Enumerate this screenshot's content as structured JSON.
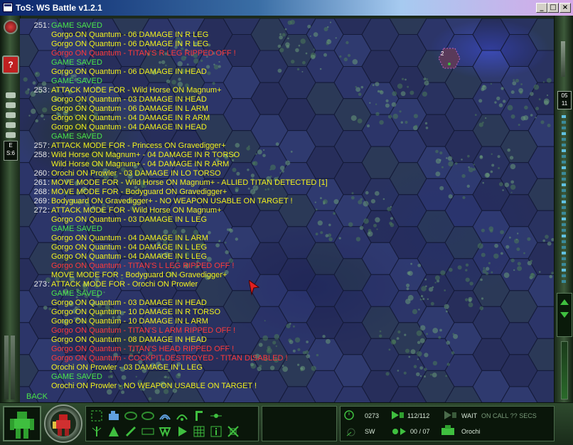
{
  "window": {
    "title": "ToS: WS Battle v1.2.1",
    "controls": {
      "minimize": "_",
      "maximize": "□",
      "close": "×"
    }
  },
  "left_rail": {
    "indicator_label": "E\nS:6"
  },
  "right_rail": {
    "counter_top": "05",
    "counter_bottom": "11",
    "bottom_value": "0"
  },
  "log": [
    {
      "num": "251",
      "text": "GAME SAVED",
      "color": "green"
    },
    {
      "num": "",
      "text": "Gorgo ON Quantum - 06 DAMAGE IN R LEG",
      "color": "yellow"
    },
    {
      "num": "",
      "text": "Gorgo ON Quantum - 06 DAMAGE IN R LEG",
      "color": "yellow"
    },
    {
      "num": "",
      "text": "Gorgo ON Quantum - TITAN'S R LEG RIPPED OFF !",
      "color": "red"
    },
    {
      "num": "",
      "text": "GAME SAVED",
      "color": "green"
    },
    {
      "num": "",
      "text": "Gorgo ON Quantum - 06 DAMAGE IN HEAD",
      "color": "yellow"
    },
    {
      "num": "",
      "text": "GAME SAVED",
      "color": "green"
    },
    {
      "num": "253",
      "text": "ATTACK MODE FOR - Wild Horse ON Magnum+",
      "color": "yellow"
    },
    {
      "num": "",
      "text": "Gorgo ON Quantum - 03 DAMAGE IN HEAD",
      "color": "yellow"
    },
    {
      "num": "",
      "text": "Gorgo ON Quantum - 06 DAMAGE IN L ARM",
      "color": "yellow"
    },
    {
      "num": "",
      "text": "Gorgo ON Quantum - 04 DAMAGE IN R ARM",
      "color": "yellow"
    },
    {
      "num": "",
      "text": "Gorgo ON Quantum - 04 DAMAGE IN HEAD",
      "color": "yellow"
    },
    {
      "num": "",
      "text": "GAME SAVED",
      "color": "green"
    },
    {
      "num": "257",
      "text": "ATTACK MODE FOR - Princess ON Gravedigger+",
      "color": "yellow"
    },
    {
      "num": "258",
      "text": "Wild Horse ON Magnum+ - 04 DAMAGE IN R TORSO",
      "color": "yellow"
    },
    {
      "num": "",
      "text": "Wild Horse ON Magnum+ - 04 DAMAGE IN R ARM",
      "color": "yellow"
    },
    {
      "num": "260",
      "text": "Orochi ON Prowler - 03 DAMAGE IN LO TORSO",
      "color": "yellow"
    },
    {
      "num": "261",
      "text": "MOVE MODE FOR - Wild Horse ON Magnum+ - ALLIED TITAN DETECTED [1]",
      "color": "yellow"
    },
    {
      "num": "268",
      "text": "MOVE MODE FOR - Bodyguard ON Gravedigger+",
      "color": "yellow"
    },
    {
      "num": "269",
      "text": "Bodyguard ON Gravedigger+ - NO WEAPON USABLE ON TARGET !",
      "color": "yellow"
    },
    {
      "num": "272",
      "text": "ATTACK MODE FOR - Wild Horse ON Magnum+",
      "color": "yellow"
    },
    {
      "num": "",
      "text": "Gorgo ON Quantum - 03 DAMAGE IN L LEG",
      "color": "yellow"
    },
    {
      "num": "",
      "text": "GAME SAVED",
      "color": "green"
    },
    {
      "num": "",
      "text": "Gorgo ON Quantum - 04 DAMAGE IN L ARM",
      "color": "yellow"
    },
    {
      "num": "",
      "text": "Gorgo ON Quantum - 04 DAMAGE IN L LEG",
      "color": "yellow"
    },
    {
      "num": "",
      "text": "Gorgo ON Quantum - 04 DAMAGE IN L LEG",
      "color": "yellow"
    },
    {
      "num": "",
      "text": "Gorgo ON Quantum - TITAN'S L LEG RIPPED OFF !",
      "color": "red"
    },
    {
      "num": "",
      "text": "MOVE MODE FOR - Bodyguard ON Gravedigger+",
      "color": "yellow"
    },
    {
      "num": "273",
      "text": "ATTACK MODE FOR - Orochi ON Prowler",
      "color": "yellow"
    },
    {
      "num": "",
      "text": "GAME SAVED",
      "color": "green"
    },
    {
      "num": "",
      "text": "Gorgo ON Quantum - 03 DAMAGE IN HEAD",
      "color": "yellow"
    },
    {
      "num": "",
      "text": "Gorgo ON Quantum - 10 DAMAGE IN R TORSO",
      "color": "yellow"
    },
    {
      "num": "",
      "text": "Gorgo ON Quantum - 10 DAMAGE IN L ARM",
      "color": "yellow"
    },
    {
      "num": "",
      "text": "Gorgo ON Quantum - TITAN'S L ARM RIPPED OFF !",
      "color": "red"
    },
    {
      "num": "",
      "text": "Gorgo ON Quantum - 08 DAMAGE IN HEAD",
      "color": "yellow"
    },
    {
      "num": "",
      "text": "Gorgo ON Quantum - TITAN'S HEAD RIPPED OFF !",
      "color": "red"
    },
    {
      "num": "",
      "text": "Gorgo ON Quantum - COCKPIT DESTROYED - TITAN DISABLED !",
      "color": "red"
    },
    {
      "num": "",
      "text": "Orochi ON Prowler - 03 DAMAGE IN L LEG",
      "color": "yellow"
    },
    {
      "num": "",
      "text": "GAME SAVED",
      "color": "green"
    },
    {
      "num": "",
      "text": "Orochi ON Prowler - NO WEAPON USABLE ON TARGET !",
      "color": "yellow"
    }
  ],
  "back_label": "BACK",
  "map_marker_label": "2",
  "status": {
    "turn": "0273",
    "armor": "112/112",
    "wait": "WAIT",
    "on_call": "ON CALL ?? SECS",
    "heading": "SW",
    "ammo": "00 / 07",
    "pilot": "Orochi"
  },
  "colors": {
    "log_green": "#4be84b",
    "log_yellow": "#f2f21e",
    "log_red": "#ff3a3a",
    "panel_green": "#3fbf3f"
  },
  "toolbar_icons": [
    "select-icon",
    "vehicle-icon",
    "ring-icon",
    "ecm-icon",
    "radio-wave-icon",
    "signal-icon",
    "crane-icon",
    "point-icon",
    "antenna-icon",
    "triangle-icon",
    "blade-icon",
    "eject-icon",
    "formation-icon",
    "play-icon",
    "grid-icon",
    "info-icon",
    "target-icon"
  ]
}
